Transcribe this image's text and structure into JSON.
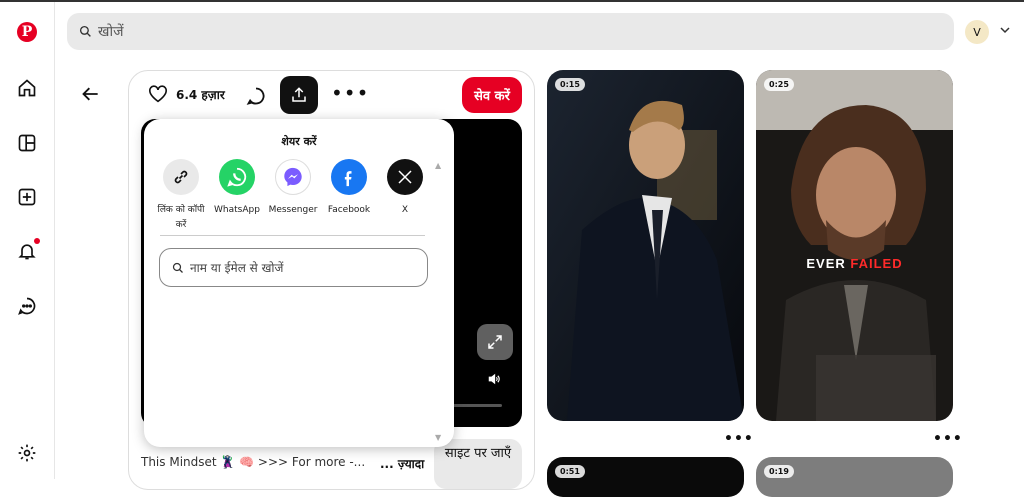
{
  "search": {
    "placeholder": "खोजें"
  },
  "user": {
    "initial": "V"
  },
  "pin": {
    "likes": "6.4 हज़ार",
    "save_label": "सेव करें",
    "description": "This Mindset 🦹‍♂️ 🧠 >>> For more -...",
    "more_label": "... ज़्यादा",
    "site_label": "साइट पर जाएँ"
  },
  "share": {
    "title": "शेयर करें",
    "options": [
      {
        "label": "लिंक को कॉपी करें",
        "icon": "link-icon",
        "color": "#e9e9e9"
      },
      {
        "label": "WhatsApp",
        "icon": "whatsapp-icon",
        "color": "#25d366"
      },
      {
        "label": "Messenger",
        "icon": "messenger-icon",
        "color": "#ffffff"
      },
      {
        "label": "Facebook",
        "icon": "facebook-icon",
        "color": "#1877f2"
      },
      {
        "label": "X",
        "icon": "x-icon",
        "color": "#111111"
      }
    ],
    "search_placeholder": "नाम या ईमेल से खोजें"
  },
  "thumbnails": [
    {
      "duration": "0:15",
      "caption": ""
    },
    {
      "duration": "0:25",
      "caption_a": "EVER",
      "caption_b": "FAILED"
    },
    {
      "duration": "0:51"
    },
    {
      "duration": "0:19"
    }
  ],
  "colors": {
    "brand": "#e60023",
    "whatsapp": "#25d366",
    "facebook": "#1877f2"
  }
}
